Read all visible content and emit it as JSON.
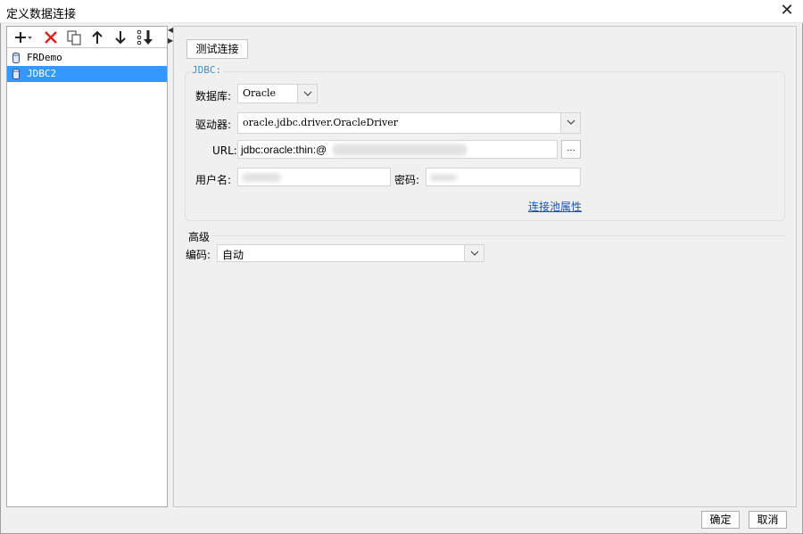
{
  "window": {
    "title": "定义数据连接",
    "close_icon": "✕"
  },
  "toolbar": {
    "icons": [
      "add-icon",
      "delete-icon",
      "copy-icon",
      "move-up-icon",
      "move-down-icon",
      "sort-icon"
    ]
  },
  "connections": [
    {
      "label": "FRDemo",
      "selected": false
    },
    {
      "label": "JDBC2",
      "selected": true
    }
  ],
  "form": {
    "test_button": "测试连接",
    "group_title": "JDBC:",
    "database_label": "数据库:",
    "database_value": "Oracle",
    "driver_label": "驱动器:",
    "driver_value": "oracle.jdbc.driver.OracleDriver",
    "url_label": "URL:",
    "url_value": "jdbc:oracle:thin:@",
    "url_browse": "...",
    "username_label": "用户名:",
    "password_label": "密码:",
    "pool_link": "连接池属性",
    "advanced_title": "高级",
    "encoding_label": "编码:",
    "encoding_value": "自动"
  },
  "footer": {
    "ok": "确定",
    "cancel": "取消"
  },
  "colors": {
    "selection": "#3399ff",
    "accent_text": "#3a8fc9",
    "link": "#0d56c4",
    "delete": "#e02020"
  }
}
